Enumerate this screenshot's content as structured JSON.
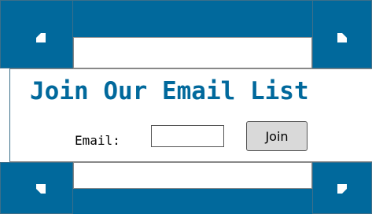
{
  "form": {
    "title": "Join Our Email List",
    "email_label": "Email:",
    "email_value": "",
    "email_placeholder": "",
    "join_label": "Join"
  },
  "icons": {
    "top_left": "corner-arrow-icon",
    "top_right": "corner-arrow-icon",
    "bottom_left": "corner-arrow-icon",
    "bottom_right": "corner-arrow-icon"
  },
  "colors": {
    "accent": "#01699c",
    "background": "#ffffff",
    "button_bg": "#d9d9d9"
  }
}
